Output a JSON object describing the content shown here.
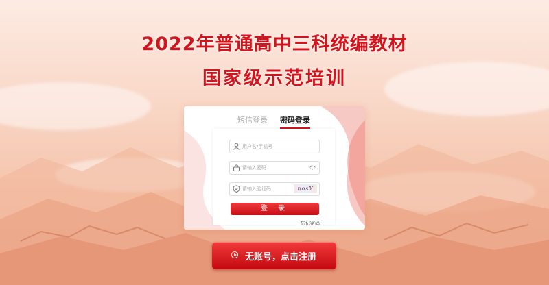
{
  "title": {
    "line1": "2022年普通高中三科统编教材",
    "line2": "国家级示范培训"
  },
  "login": {
    "tabs": [
      {
        "label": "短信登录",
        "active": false
      },
      {
        "label": "密码登录",
        "active": true
      }
    ],
    "username": {
      "placeholder": "用户名/手机号",
      "value": ""
    },
    "password": {
      "placeholder": "请输入密码",
      "value": ""
    },
    "captcha": {
      "placeholder": "请输入验证码",
      "value": "",
      "image_text": "nosY"
    },
    "login_button": "登 录",
    "forgot_link": "忘记密码"
  },
  "register": {
    "label": "无账号，点击注册"
  },
  "colors": {
    "accent": "#d4141c",
    "button": "#c80d16"
  },
  "icons": {
    "user": "user-icon",
    "lock": "lock-icon",
    "shield": "shield-icon",
    "eye": "eye-icon",
    "play": "play-circle-icon"
  }
}
